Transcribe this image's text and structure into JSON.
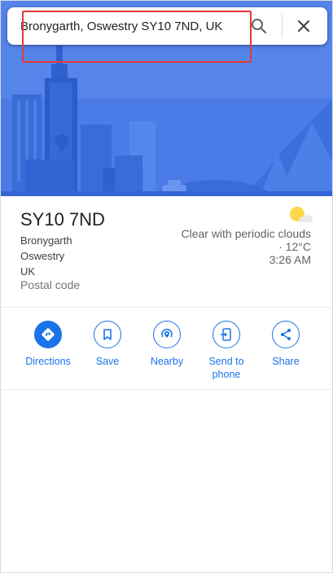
{
  "search": {
    "value": "Bronygarth, Oswestry SY10 7ND, UK",
    "search_icon": "search-icon",
    "close_icon": "close-icon"
  },
  "place": {
    "title": "SY10 7ND",
    "address_lines": [
      "Bronygarth",
      "Oswestry",
      "UK"
    ],
    "category": "Postal code"
  },
  "weather": {
    "icon": "partly-cloudy-icon",
    "condition": "Clear with periodic clouds · 12°C",
    "time": "3:26 AM"
  },
  "actions": [
    {
      "label": "Directions",
      "icon": "directions-icon"
    },
    {
      "label": "Save",
      "icon": "bookmark-icon"
    },
    {
      "label": "Nearby",
      "icon": "nearby-icon"
    },
    {
      "label": "Send to phone",
      "icon": "send-to-phone-icon"
    },
    {
      "label": "Share",
      "icon": "share-icon"
    }
  ],
  "colors": {
    "accent": "#1a73e8",
    "hero_background": "#4a7be6",
    "highlight_box": "#e53935"
  }
}
